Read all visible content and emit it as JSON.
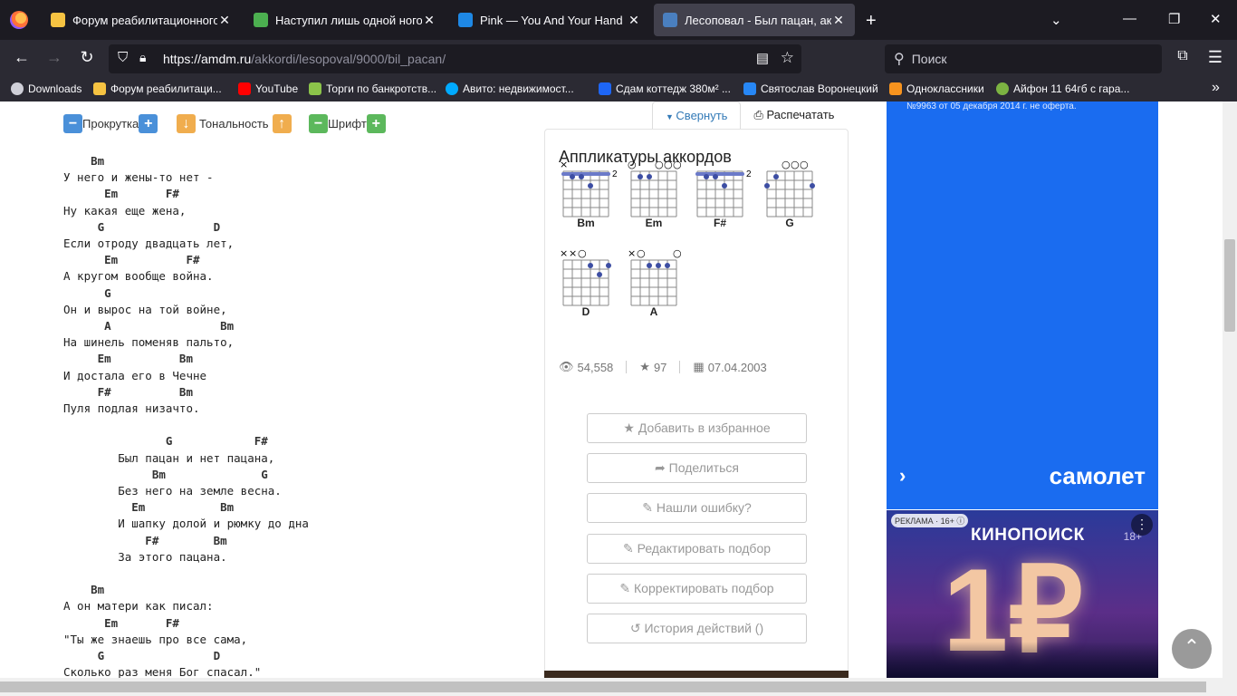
{
  "browser": {
    "tabs": [
      {
        "title": "Форум реабилитационного це",
        "favicon_color": "#f6c342"
      },
      {
        "title": "Наступил лишь одной ногой,",
        "favicon_color": "#4caf50"
      },
      {
        "title": "Pink — You And Your Hand",
        "favicon_color": "#1e88e5"
      },
      {
        "title": "Лесоповал - Был пацан, аккор",
        "favicon_color": "#4a7fbf"
      }
    ],
    "url_host": "https://amdm.ru",
    "url_path": "/akkordi/lesopoval/9000/bil_pacan/",
    "search_placeholder": "Поиск",
    "bookmarks": [
      {
        "label": "Downloads",
        "color": "#cfcfd8"
      },
      {
        "label": "Форум реабилитаци...",
        "color": "#f6c342"
      },
      {
        "label": "YouTube",
        "color": "#ff0000"
      },
      {
        "label": "Торги по банкротств...",
        "color": "#8bc34a"
      },
      {
        "label": "Авито: недвижимост...",
        "color": "#00aaff"
      },
      {
        "label": "Сдам коттедж 380м² ...",
        "color": "#1e66f5"
      },
      {
        "label": "Святослав Воронецкий",
        "color": "#2787f5"
      },
      {
        "label": "Одноклассники",
        "color": "#f7931e"
      },
      {
        "label": "Айфон 11 64гб с гара...",
        "color": "#7cb342"
      }
    ]
  },
  "toolbar": {
    "scroll_label": "Прокрутка",
    "key_label": "Тональность",
    "font_label": "Шрифт",
    "minus": "−",
    "plus": "+",
    "down": "↓",
    "up": "↑"
  },
  "lyrics": [
    {
      "c": "    Bm"
    },
    {
      "t": "У него и жены-то нет -"
    },
    {
      "c": "      Em       F#"
    },
    {
      "t": "Ну какая еще жена,"
    },
    {
      "c": "     G                D"
    },
    {
      "t": "Если отроду двадцать лет,"
    },
    {
      "c": "      Em          F#"
    },
    {
      "t": "А кругом вообще война."
    },
    {
      "c": "      G"
    },
    {
      "t": "Он и вырос на той войне,"
    },
    {
      "c": "      A                Bm"
    },
    {
      "t": "На шинель поменяв пальто,"
    },
    {
      "c": "     Em          Bm"
    },
    {
      "t": "И достала его в Чечне"
    },
    {
      "c": "     F#          Bm"
    },
    {
      "t": "Пуля подлая низачто."
    },
    {
      "t": ""
    },
    {
      "c": "               G            F#"
    },
    {
      "t": "        Был пацан и нет пацана,"
    },
    {
      "c": "             Bm              G"
    },
    {
      "t": "        Без него на земле весна."
    },
    {
      "c": "          Em           Bm"
    },
    {
      "t": "        И шапку долой и рюмку до дна"
    },
    {
      "c": "            F#        Bm"
    },
    {
      "t": "        За этого пацана."
    },
    {
      "t": ""
    },
    {
      "c": "    Bm"
    },
    {
      "t": "А он матери как писал:"
    },
    {
      "c": "      Em       F#"
    },
    {
      "t": "\"Ты же знаешь про все сама,"
    },
    {
      "c": "     G                D"
    },
    {
      "t": "Сколько раз меня Бог спасал.\""
    }
  ],
  "panel": {
    "collapse_label": "Свернуть",
    "print_label": "Распечатать",
    "chords_title": "Аппликатуры аккордов",
    "chords": [
      "Bm",
      "Em",
      "F#",
      "G",
      "D",
      "A"
    ],
    "views": "54,558",
    "stars": "97",
    "date": "07.04.2003",
    "buttons": [
      {
        "icon": "★",
        "label": "Добавить в избранное"
      },
      {
        "icon": "➦",
        "label": "Поделиться"
      },
      {
        "icon": "✎",
        "label": "Нашли ошибку?"
      },
      {
        "icon": "✎",
        "label": "Редактировать подбор"
      },
      {
        "icon": "✎",
        "label": "Корректировать подбор"
      },
      {
        "icon": "↺",
        "label": "История действий ()"
      }
    ]
  },
  "ads": {
    "top_small": "№9963 от 05 декабря 2014 г. не оферта.",
    "samolet_label": "самолет",
    "samolet_arrow": "›",
    "reklama": "РЕКЛАМА · 16+ ⓘ",
    "kinopoisk": "КИНОПОИСК",
    "age": "18+",
    "price": "1₽",
    "menu": "⋮"
  },
  "scroll_top_icon": "⌃",
  "colors": {
    "blue_btn": "#4a90d9",
    "orange_btn": "#f0ad4e",
    "green_btn": "#5cb85c",
    "chord_dot": "#3d4ea3",
    "barre": "#6b7ac9"
  }
}
